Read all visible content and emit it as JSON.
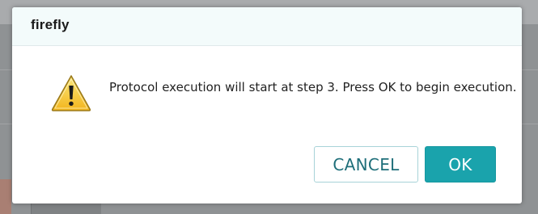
{
  "dialog": {
    "title": "firefly",
    "message": "Protocol execution will start at step 3. Press OK to begin execution.",
    "icon": "warning-icon",
    "cancel_label": "CANCEL",
    "ok_label": "OK"
  },
  "colors": {
    "header_bg": "#f3fbfb",
    "ok_bg": "#1aa3ac",
    "cancel_text": "#1f6f7a",
    "cancel_border": "#a8d3d8"
  }
}
